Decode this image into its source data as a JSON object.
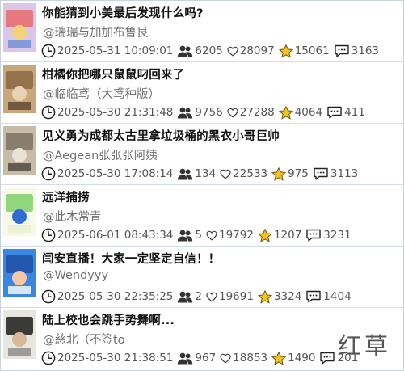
{
  "items": [
    {
      "title": "你能猜到小美最后发现什么吗?",
      "author": "@瑞瑞与加加布鲁艮",
      "date": "2025-05-31 10:09:01",
      "plays": "6205",
      "likes": "28097",
      "favorites": "15061",
      "comments": "3163",
      "thumb_colors": [
        "#d9c6e8",
        "#e86b6b",
        "#f3d37a",
        "#6c8fd6"
      ]
    },
    {
      "title": "柑橘你把哪只鼠鼠叼回来了",
      "author": "@临临鸢（大鸢种版）",
      "date": "2025-05-30 21:31:48",
      "plays": "9756",
      "likes": "27288",
      "favorites": "4064",
      "comments": "411",
      "thumb_colors": [
        "#c9a77a",
        "#8a6a44",
        "#e6d3b3",
        "#5a4630"
      ]
    },
    {
      "title": "见义勇为成都太古里拿垃圾桶的黑衣小哥巨帅",
      "author": "@Aegean张张张阿姨",
      "date": "2025-05-30 17:08:14",
      "plays": "134",
      "likes": "22533",
      "favorites": "975",
      "comments": "3113",
      "thumb_colors": [
        "#c8bca9",
        "#7d7366",
        "#e9e2d6",
        "#4b443b"
      ]
    },
    {
      "title": "远洋捕捞",
      "author": "@此木常青",
      "date": "2025-06-01 08:43:34",
      "plays": "5",
      "likes": "19792",
      "favorites": "1207",
      "comments": "3231",
      "thumb_colors": [
        "#f5f9e6",
        "#7fcf6a",
        "#2f6bd1",
        "#e8f1d2"
      ]
    },
    {
      "title": "闫安直播！大家一定坚定自信！！",
      "author": "@Wendyyy",
      "date": "2025-05-30 22:35:25",
      "plays": "2",
      "likes": "19691",
      "favorites": "3324",
      "comments": "1404",
      "thumb_colors": [
        "#3b86e0",
        "#1f4fa3",
        "#f2c9a8",
        "#ffffff"
      ]
    },
    {
      "title": "陆上校也会跳手势舞啊...",
      "author": "@慈北（不签to",
      "date": "2025-05-30 21:38:51",
      "plays": "967",
      "likes": "18853",
      "favorites": "1490",
      "comments": "201",
      "thumb_colors": [
        "#e9e6e2",
        "#1b1b1b",
        "#d9b89a",
        "#8a8a8a"
      ]
    }
  ],
  "watermark": "红草"
}
